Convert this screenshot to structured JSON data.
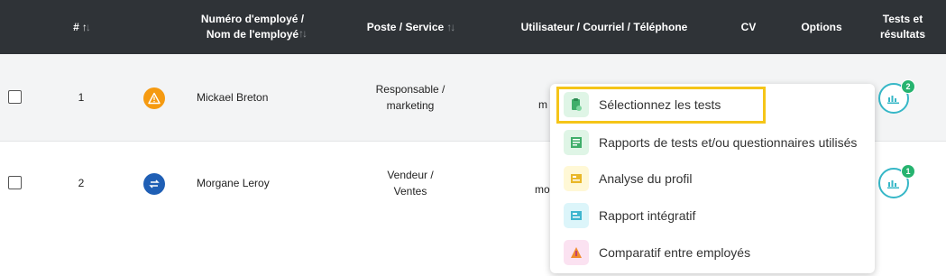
{
  "header": {
    "num": "#",
    "employee": "Numéro d'employé /\nNom de l'employé",
    "position": "Poste / Service",
    "user": "Utilisateur / Courriel / Téléphone",
    "cv": "CV",
    "options": "Options",
    "tests": "Tests et\nrésultats"
  },
  "rows": [
    {
      "num": "1",
      "status_icon": "warning-icon",
      "name": "Mickael Breton",
      "position": "Responsable /\nmarketing",
      "user_partial": "m",
      "tests_count": "2"
    },
    {
      "num": "2",
      "status_icon": "sync-icon",
      "name": "Morgane Leroy",
      "position": "Vendeur /\nVentes",
      "user_partial": "mo",
      "tests_count": "1"
    }
  ],
  "menu": {
    "items": [
      {
        "label": "Sélectionnez les tests",
        "icon": "test-select-icon",
        "color": "#dff5e6"
      },
      {
        "label": "Rapports de tests et/ou questionnaires utilisés",
        "icon": "report-icon",
        "color": "#dff5e6"
      },
      {
        "label": "Analyse du profil",
        "icon": "profile-analysis-icon",
        "color": "#fff8d6"
      },
      {
        "label": "Rapport intégratif",
        "icon": "integrative-report-icon",
        "color": "#dcf5fa"
      },
      {
        "label": "Comparatif entre employés",
        "icon": "compare-icon",
        "color": "#fbe2f1"
      }
    ]
  },
  "colors": {
    "header_bg": "#2f3337",
    "accent": "#36b7c7",
    "highlight": "#f5c518",
    "badge": "#26b36f"
  }
}
